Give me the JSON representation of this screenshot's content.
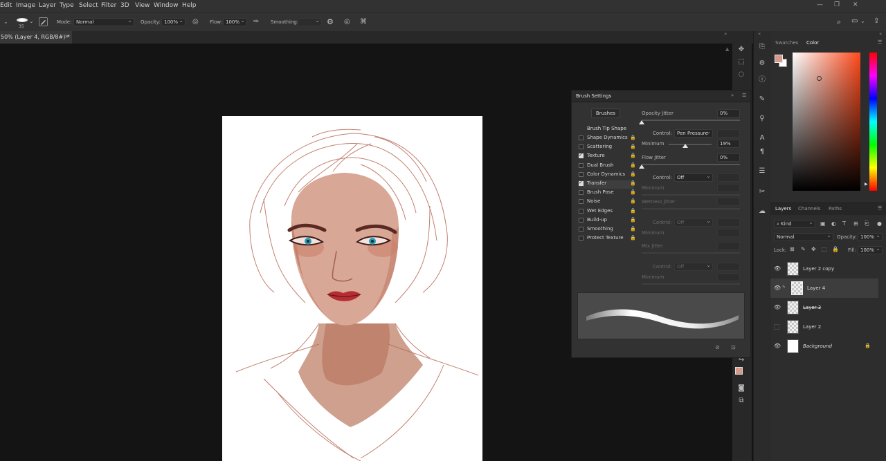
{
  "menu": [
    "Edit",
    "Image",
    "Layer",
    "Type",
    "Select",
    "Filter",
    "3D",
    "View",
    "Window",
    "Help"
  ],
  "options": {
    "brush_size": "35",
    "mode_label": "Mode:",
    "mode_value": "Normal",
    "opacity_label": "Opacity:",
    "opacity_value": "100%",
    "flow_label": "Flow:",
    "flow_value": "100%",
    "smoothing_label": "Smoothing:"
  },
  "document": {
    "tab_title": "50% (Layer 4, RGB/8#) *",
    "close": "×"
  },
  "color_panel": {
    "tabs": [
      "Swatches",
      "Color"
    ],
    "active_tab": "Color",
    "foreground": "#d49a8a",
    "hue": "#ff4a1c"
  },
  "brush_settings": {
    "title": "Brush Settings",
    "brushes_button": "Brushes",
    "tip_shape": "Brush Tip Shape",
    "items": [
      {
        "label": "Shape Dynamics",
        "checked": false
      },
      {
        "label": "Scattering",
        "checked": false
      },
      {
        "label": "Texture",
        "checked": true
      },
      {
        "label": "Dual Brush",
        "checked": false
      },
      {
        "label": "Color Dynamics",
        "checked": false
      },
      {
        "label": "Transfer",
        "checked": true
      },
      {
        "label": "Brush Pose",
        "checked": false
      },
      {
        "label": "Noise",
        "checked": false
      },
      {
        "label": "Wet Edges",
        "checked": false
      },
      {
        "label": "Build-up",
        "checked": false
      },
      {
        "label": "Smoothing",
        "checked": false
      },
      {
        "label": "Protect Texture",
        "checked": false
      }
    ],
    "opacity_jitter_label": "Opacity Jitter",
    "opacity_jitter_value": "0%",
    "control_label": "Control:",
    "control1_value": "Pen Pressure",
    "minimum_label": "Minimum",
    "minimum_value": "19%",
    "minimum_fraction": 0.19,
    "flow_jitter_label": "Flow Jitter",
    "flow_jitter_value": "0%",
    "control2_value": "Off",
    "wetness_jitter_label": "Wetness Jitter",
    "control3_value": "Off",
    "mix_jitter_label": "Mix Jitter",
    "control4_value": "Off"
  },
  "layers_panel": {
    "tabs": [
      "Layers",
      "Channels",
      "Paths"
    ],
    "kind": "Kind",
    "blend_mode": "Normal",
    "opacity_label": "Opacity:",
    "opacity_value": "100%",
    "lock_label": "Lock:",
    "fill_label": "Fill:",
    "fill_value": "100%",
    "layers": [
      {
        "name": "Layer 2 copy",
        "visible": true,
        "selected": false
      },
      {
        "name": "Layer 4",
        "visible": true,
        "selected": true
      },
      {
        "name": "Layer 3",
        "visible": true,
        "selected": false
      },
      {
        "name": "Layer 2",
        "visible": false,
        "selected": false
      },
      {
        "name": "Background",
        "visible": true,
        "selected": false
      }
    ]
  }
}
